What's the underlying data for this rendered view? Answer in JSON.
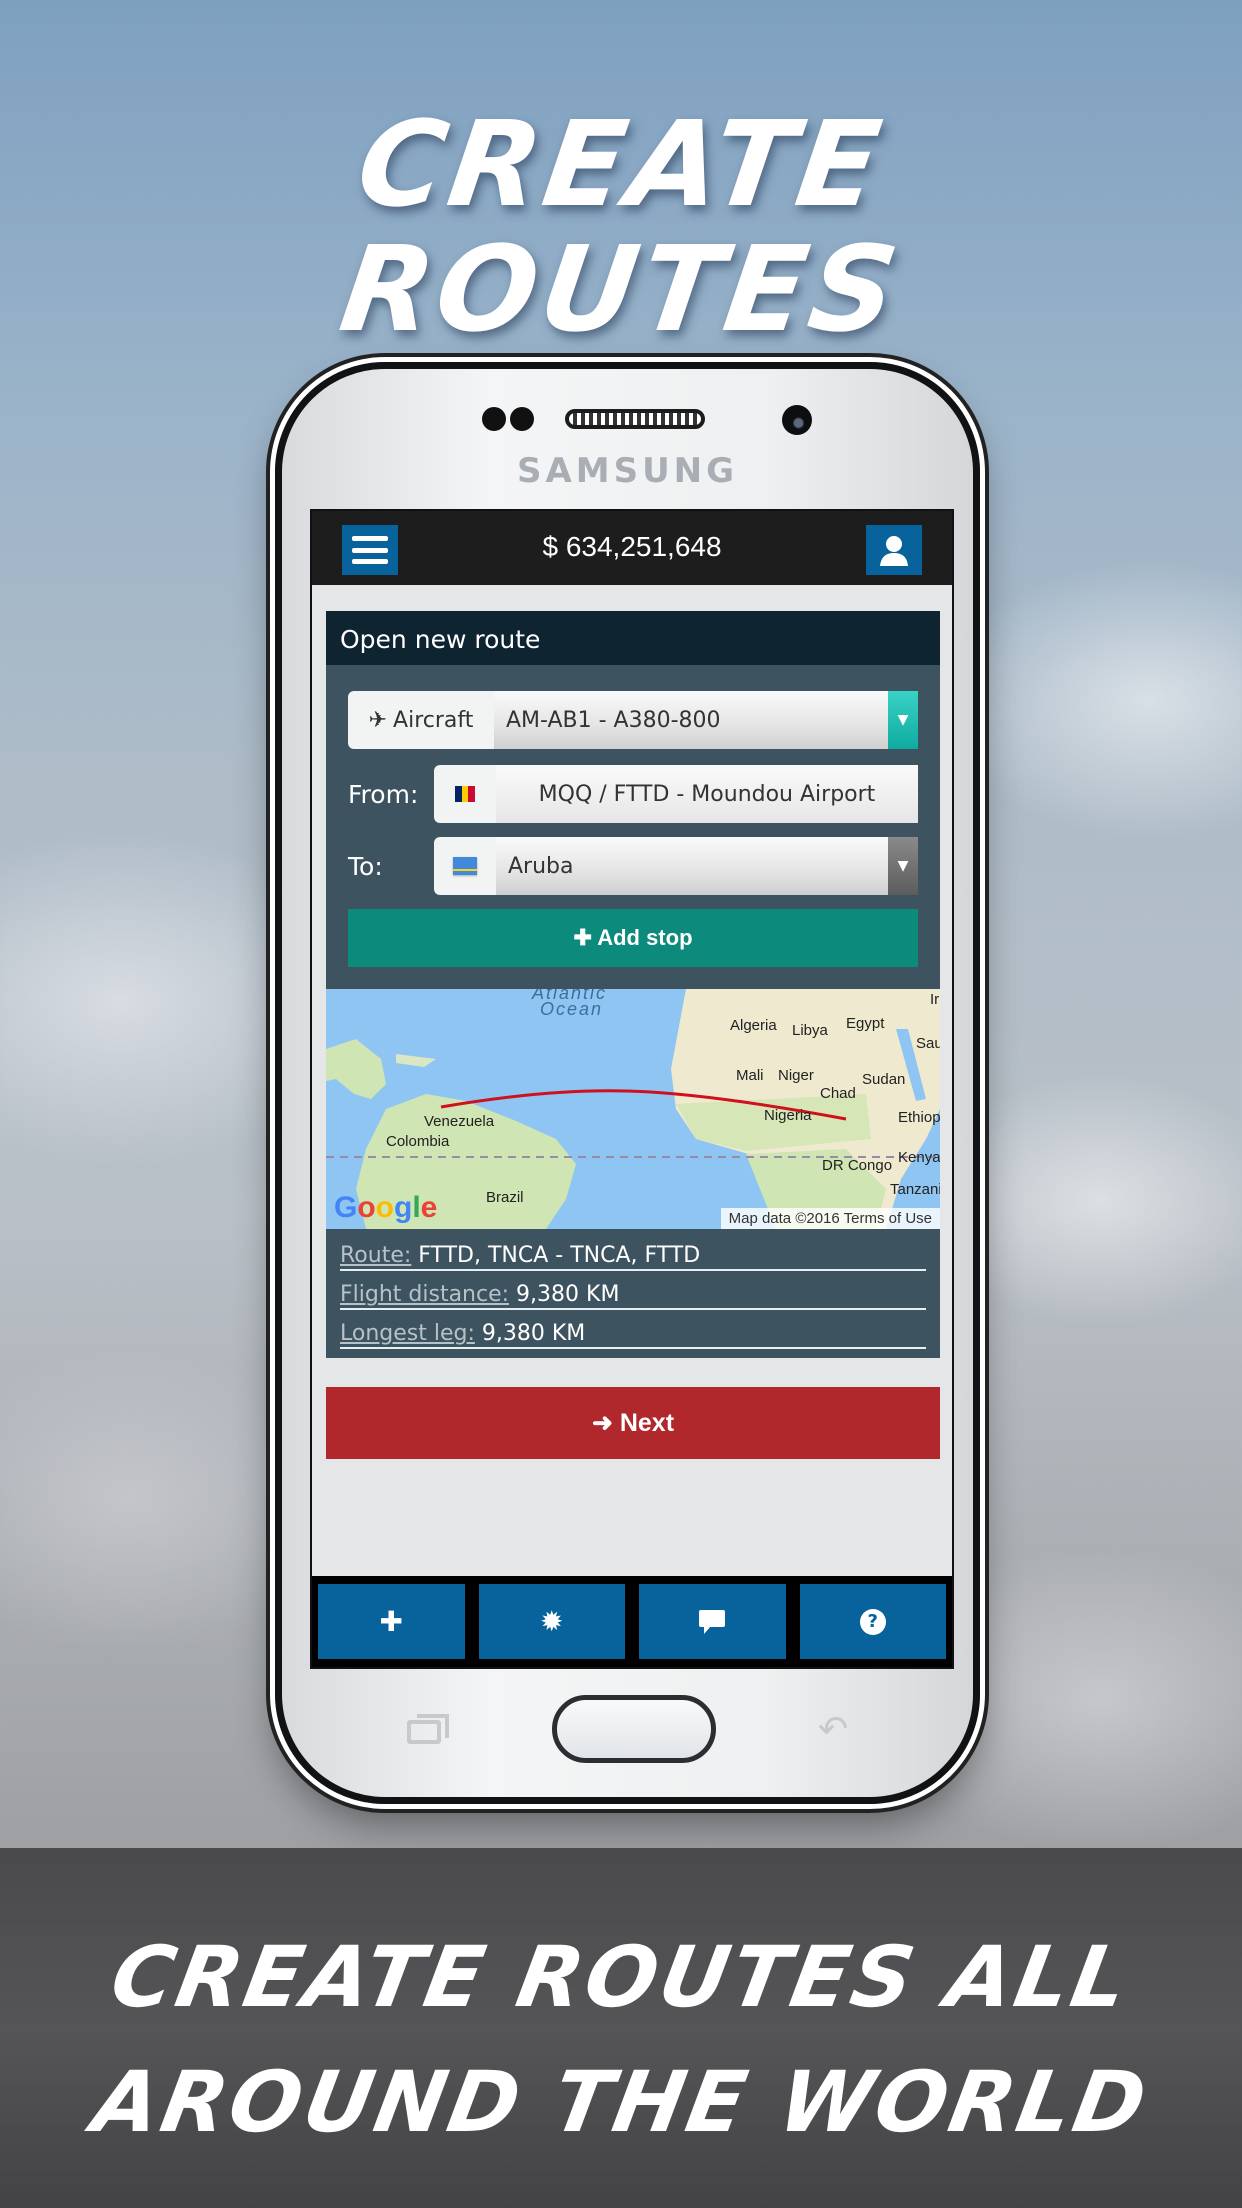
{
  "promo": {
    "headline_line1": "CREATE",
    "headline_line2": "ROUTES",
    "tagline_line1": "CREATE ROUTES ALL",
    "tagline_line2": "AROUND THE WORLD"
  },
  "device": {
    "brand": "SAMSUNG",
    "back_glyph": "↶"
  },
  "app": {
    "topbar": {
      "menu_icon": "hamburger-icon",
      "balance": "$ 634,251,648",
      "user_icon": "user-icon"
    },
    "card": {
      "title": "Open new route",
      "aircraft": {
        "label_icon": "✈",
        "label": "Aircraft",
        "selected": "AM-AB1 - A380-800",
        "caret": "▼"
      },
      "from": {
        "label": "From:",
        "flag": "chad",
        "value": "MQQ / FTTD - Moundou Airport"
      },
      "to": {
        "label": "To:",
        "flag": "aruba",
        "selected": "Aruba",
        "caret": "▼"
      },
      "add_stop_label": "✚ Add stop"
    },
    "map": {
      "labels": {
        "ocean": "Atlantic",
        "ocean2": "Ocean",
        "algeria": "Algeria",
        "libya": "Libya",
        "egypt": "Egypt",
        "saudi": "Sau",
        "mali": "Mali",
        "niger": "Niger",
        "sudan": "Sudan",
        "chad": "Chad",
        "nigeria": "Nigeria",
        "ethiopia": "Ethiop",
        "venezuela": "Venezuela",
        "colombia": "Colombia",
        "kenya": "Kenya",
        "drcongo": "DR Congo",
        "tanzania": "Tanzani",
        "brazil": "Brazil",
        "iran": "Ir"
      },
      "google_logo": "Google",
      "attribution": "Map data ©2016  Terms of Use",
      "route_color": "#d0101c"
    },
    "summary": {
      "route_key": "Route:",
      "route_val": "FTTD, TNCA - TNCA, FTTD",
      "distance_key": "Flight distance:",
      "distance_val": "9,380 KM",
      "longest_key": "Longest leg:",
      "longest_val": "9,380 KM"
    },
    "next_label": "➜ Next",
    "bottom_nav": [
      {
        "name": "add",
        "glyph": "✚"
      },
      {
        "name": "badge",
        "glyph": "✹"
      },
      {
        "name": "chat",
        "glyph": "▬"
      },
      {
        "name": "help",
        "glyph": "?"
      }
    ]
  },
  "colors": {
    "topbar_bg": "#1d1d1e",
    "accent_blue": "#08629c",
    "card_header": "#0e2430",
    "form_bg": "#3e5360",
    "add_stop": "#0c8a7c",
    "next": "#b0282b"
  }
}
